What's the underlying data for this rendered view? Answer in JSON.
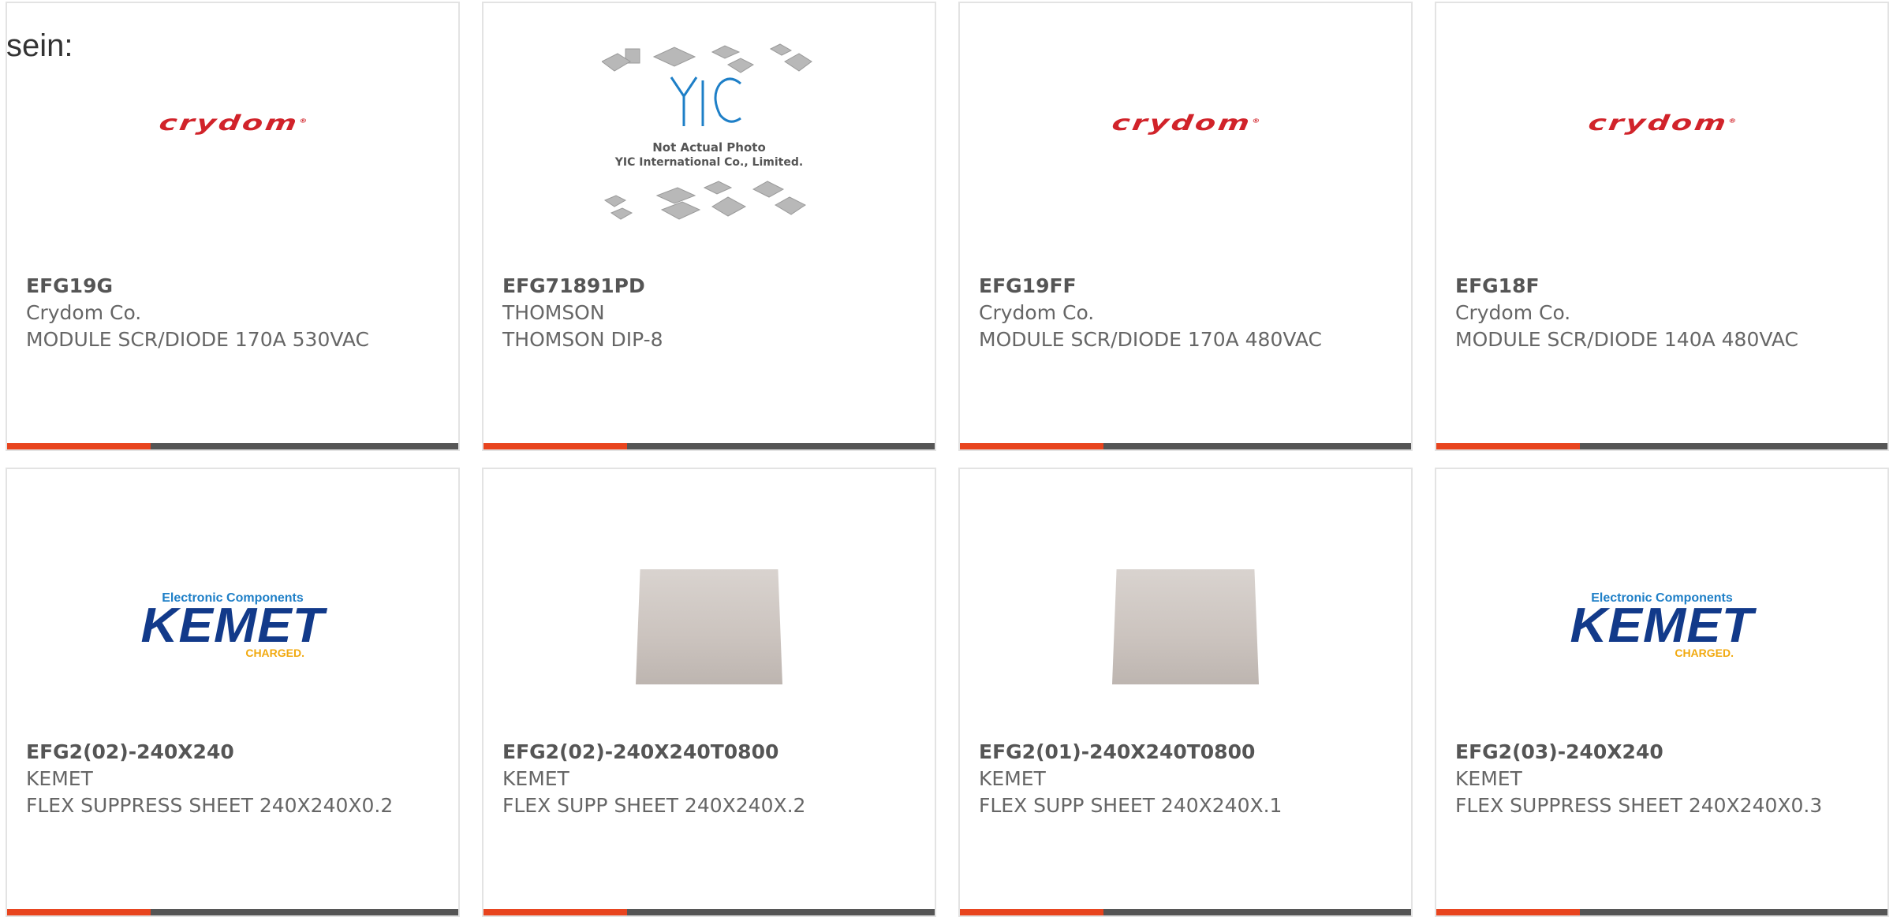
{
  "lead_text": "sein:",
  "products": [
    {
      "part_no": "EFG19G",
      "manufacturer": "Crydom Co.",
      "description": "MODULE SCR/DIODE 170A 530VAC",
      "image": "crydom-logo"
    },
    {
      "part_no": "EFG71891PD",
      "manufacturer": "THOMSON",
      "description": "THOMSON DIP-8",
      "image": "not-actual-photo",
      "image_text_1": "Not Actual Photo",
      "image_text_2": "YIC International Co., Limited."
    },
    {
      "part_no": "EFG19FF",
      "manufacturer": "Crydom Co.",
      "description": "MODULE SCR/DIODE 170A 480VAC",
      "image": "crydom-logo"
    },
    {
      "part_no": "EFG18F",
      "manufacturer": "Crydom Co.",
      "description": "MODULE SCR/DIODE 140A 480VAC",
      "image": "crydom-logo"
    },
    {
      "part_no": "EFG2(02)-240X240",
      "manufacturer": "KEMET",
      "description": "FLEX SUPPRESS SHEET 240X240X0.2",
      "image": "kemet-logo"
    },
    {
      "part_no": "EFG2(02)-240X240T0800",
      "manufacturer": "KEMET",
      "description": "FLEX SUPP SHEET 240X240X.2",
      "image": "sheet-photo"
    },
    {
      "part_no": "EFG2(01)-240X240T0800",
      "manufacturer": "KEMET",
      "description": "FLEX SUPP SHEET 240X240X.1",
      "image": "sheet-photo"
    },
    {
      "part_no": "EFG2(03)-240X240",
      "manufacturer": "KEMET",
      "description": "FLEX SUPPRESS SHEET 240X240X0.3",
      "image": "kemet-logo"
    }
  ],
  "logos": {
    "crydom": "crydom",
    "kemet_top": "Electronic Components",
    "kemet_main": "KEMET",
    "kemet_bottom": "CHARGED.",
    "yic": "YIC"
  },
  "colors": {
    "accent": "#e8441e",
    "bar": "#555555",
    "crydom_red": "#d1232a",
    "kemet_blue": "#123a8a",
    "kemet_yellow": "#f1a90f"
  }
}
